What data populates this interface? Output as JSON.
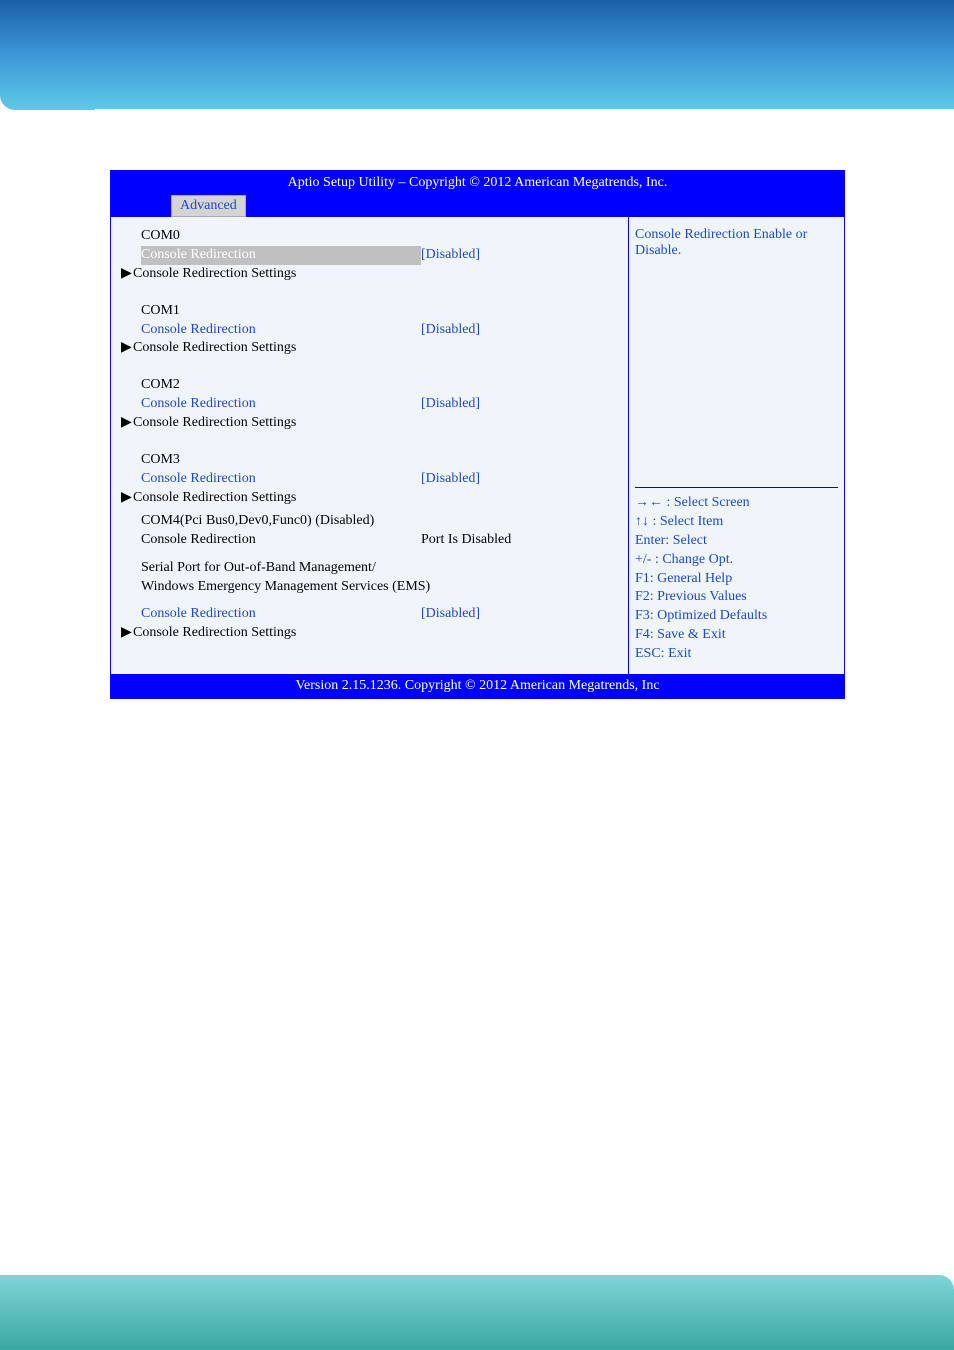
{
  "header": {
    "title": "Aptio Setup Utility  –  Copyright © 2012 American Megatrends, Inc.",
    "tab": "Advanced"
  },
  "footer": "Version 2.15.1236. Copyright © 2012 American Megatrends, Inc",
  "help": {
    "description": "Console Redirection Enable or Disable.",
    "keys": {
      "arrows_lr": "→← : Select Screen",
      "arrows_ud": "↑↓ : Select Item",
      "enter": "Enter: Select",
      "plusminus": "+/- : Change Opt.",
      "f1": "F1: General Help",
      "f2": "F2: Previous Values",
      "f3": "F3: Optimized Defaults",
      "f4": "F4: Save & Exit",
      "esc": "ESC: Exit"
    }
  },
  "com0": {
    "header": "COM0",
    "redirect_label": "Console Redirection",
    "redirect_value": "[Disabled]",
    "settings": "Console Redirection Settings"
  },
  "com1": {
    "header": "COM1",
    "redirect_label": "Console Redirection",
    "redirect_value": "[Disabled]",
    "settings": "Console Redirection Settings"
  },
  "com2": {
    "header": "COM2",
    "redirect_label": "Console Redirection",
    "redirect_value": "[Disabled]",
    "settings": "Console Redirection Settings"
  },
  "com3": {
    "header": "COM3",
    "redirect_label": "Console Redirection",
    "redirect_value": "[Disabled]",
    "settings": "Console Redirection Settings"
  },
  "com4": {
    "header": "COM4(Pci Bus0,Dev0,Func0)  (Disabled)",
    "redirect_label": "Console Redirection",
    "redirect_value": "Port Is Disabled"
  },
  "oob": {
    "line1": "Serial Port for Out-of-Band Management/",
    "line2": "Windows Emergency Management Services (EMS)"
  },
  "ems": {
    "redirect_label": "Console Redirection",
    "redirect_value": "[Disabled]",
    "settings": "Console Redirection Settings"
  }
}
